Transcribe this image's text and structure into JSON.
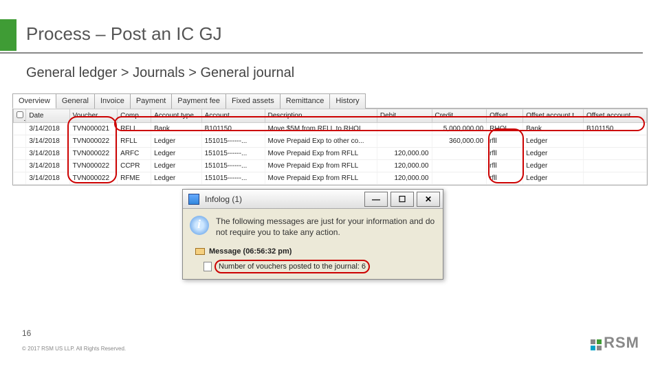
{
  "title": "Process – Post an IC GJ",
  "breadcrumb": "General ledger > Journals > General journal",
  "tabs": [
    "Overview",
    "General",
    "Invoice",
    "Payment",
    "Payment fee",
    "Fixed assets",
    "Remittance",
    "History"
  ],
  "columns": [
    "",
    "Date",
    "Voucher",
    "Comp...",
    "Account type",
    "Account",
    "Description",
    "Debit",
    "Credit",
    "Offset ...",
    "Offset account t...",
    "Offset account"
  ],
  "rows": [
    {
      "date": "3/14/2018",
      "voucher": "TVN000021",
      "company": "RFLL",
      "acct_type": "Bank",
      "account": "B101150",
      "desc": "Move $5M from RFLL to RHOL",
      "debit": "",
      "credit": "5,000,000.00",
      "offset_co": "RHOL",
      "offset_type": "Bank",
      "offset_acct": "B101150"
    },
    {
      "date": "3/14/2018",
      "voucher": "TVN000022",
      "company": "RFLL",
      "acct_type": "Ledger",
      "account": "151015------...",
      "desc": "Move Prepaid Exp to other co...",
      "debit": "",
      "credit": "360,000.00",
      "offset_co": "rfll",
      "offset_type": "Ledger",
      "offset_acct": ""
    },
    {
      "date": "3/14/2018",
      "voucher": "TVN000022",
      "company": "ARFC",
      "acct_type": "Ledger",
      "account": "151015------...",
      "desc": "Move Prepaid Exp from RFLL",
      "debit": "120,000.00",
      "credit": "",
      "offset_co": "rfll",
      "offset_type": "Ledger",
      "offset_acct": ""
    },
    {
      "date": "3/14/2018",
      "voucher": "TVN000022",
      "company": "CCPR",
      "acct_type": "Ledger",
      "account": "151015------...",
      "desc": "Move Prepaid Exp from RFLL",
      "debit": "120,000.00",
      "credit": "",
      "offset_co": "rfll",
      "offset_type": "Ledger",
      "offset_acct": ""
    },
    {
      "date": "3/14/2018",
      "voucher": "TVN000022",
      "company": "RFME",
      "acct_type": "Ledger",
      "account": "151015------...",
      "desc": "Move Prepaid Exp from RFLL",
      "debit": "120,000.00",
      "credit": "",
      "offset_co": "rfll",
      "offset_type": "Ledger",
      "offset_acct": ""
    }
  ],
  "infolog": {
    "title": "Infolog (1)",
    "body": "The following messages are just for your information and do not require you to take any action.",
    "msg_header": "Message (06:56:32 pm)",
    "msg_line": "Number of vouchers posted to the journal: 6"
  },
  "page_number": "16",
  "copyright": "© 2017 RSM US LLP. All Rights Reserved.",
  "logo_text": "RSM"
}
